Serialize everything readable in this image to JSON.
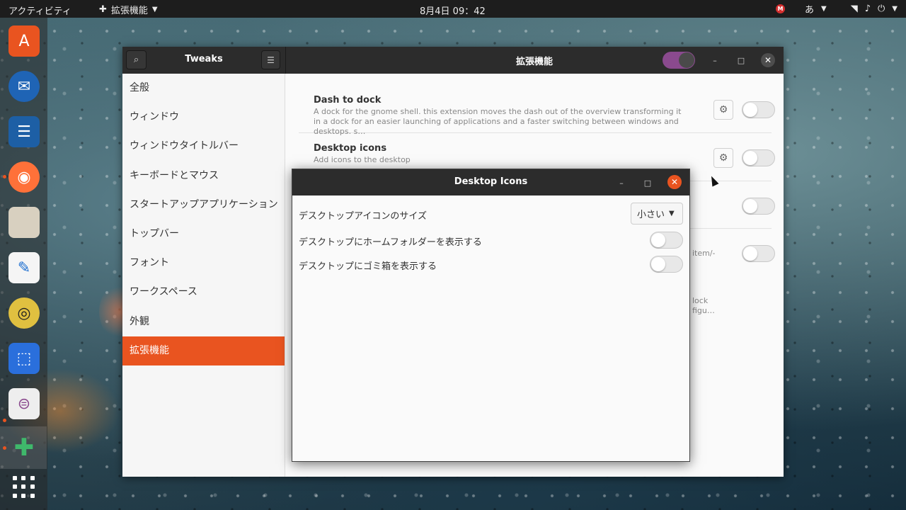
{
  "topbar": {
    "activities": "アクティビティ",
    "app_menu": "拡張機能",
    "clock": "8月4日  09：42",
    "ime": "あ"
  },
  "tweaks": {
    "title": "Tweaks",
    "section_title": "拡張機能",
    "sidebar": [
      "全般",
      "ウィンドウ",
      "ウィンドウタイトルバー",
      "キーボードとマウス",
      "スタートアップアプリケーション",
      "トップバー",
      "フォント",
      "ワークスペース",
      "外観",
      "拡張機能"
    ],
    "selected_index": 9,
    "extensions": [
      {
        "name": "Dash to dock",
        "desc": "A dock for the gnome shell. this extension moves the dash out of the overview transforming it in a dock for an easier launching of applications and a faster switching between windows and desktops. s…"
      },
      {
        "name": "Desktop icons",
        "desc": "Add icons to the desktop"
      }
    ],
    "fragment_row3": "item/-",
    "fragment_row4a": "lock",
    "fragment_row4b": "figu…"
  },
  "dialog": {
    "title": "Desktop Icons",
    "icon_size_label": "デスクトップアイコンのサイズ",
    "icon_size_value": "小さい",
    "home_folder_label": "デスクトップにホームフォルダーを表示する",
    "trash_label": "デスクトップにゴミ箱を表示する",
    "home_folder_enabled": false,
    "trash_enabled": false
  },
  "colors": {
    "accent": "#e95420",
    "master_switch": "#8a4a8e"
  }
}
